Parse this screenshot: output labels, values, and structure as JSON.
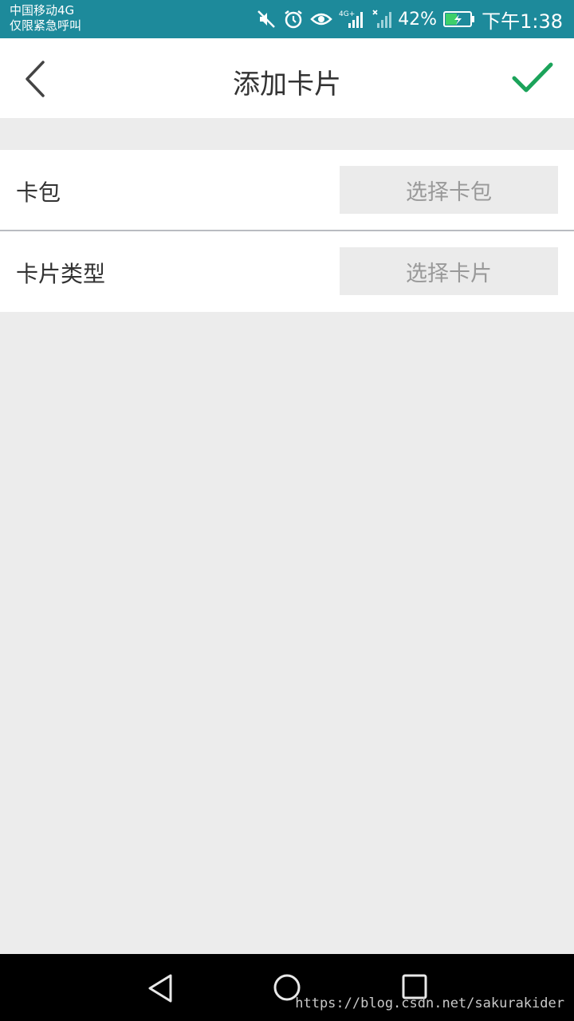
{
  "status_bar": {
    "carrier": "中国移动4G",
    "emergency": "仅限紧急呼叫",
    "network": "4G",
    "battery_percent": "42%",
    "time": "下午1:38",
    "icons": [
      "mute-icon",
      "alarm-icon",
      "eye-comfort-icon",
      "signal-icon",
      "wifi-off-signal-icon",
      "battery-charging-icon"
    ]
  },
  "header": {
    "title": "添加卡片",
    "back_icon": "chevron-left-icon",
    "confirm_icon": "check-icon",
    "confirm_color": "#1ba35a"
  },
  "form": {
    "rows": [
      {
        "label": "卡包",
        "select_text": "选择卡包"
      },
      {
        "label": "卡片类型",
        "select_text": "选择卡片"
      }
    ]
  },
  "nav_bar": {
    "buttons": [
      "back-triangle-icon",
      "home-circle-icon",
      "recent-square-icon"
    ]
  },
  "watermark": "https://blog.csdn.net/sakurakider"
}
